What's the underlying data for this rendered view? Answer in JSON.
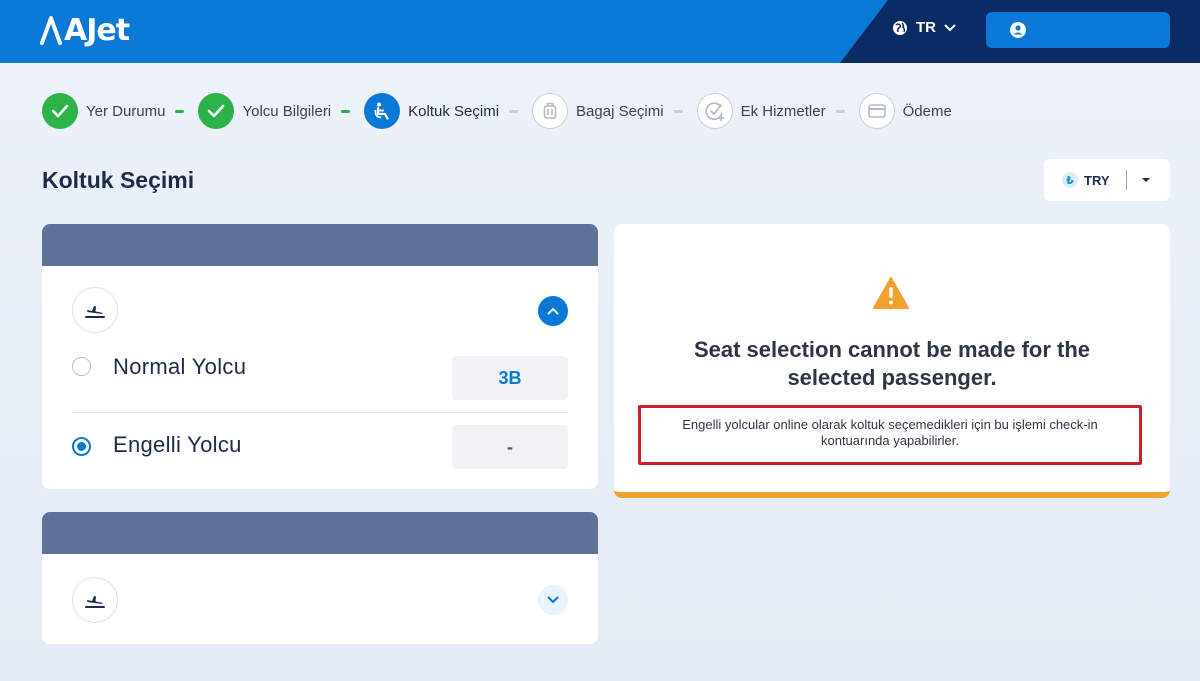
{
  "header": {
    "logo_text": "AJet",
    "language": "TR",
    "colors": {
      "primary": "#0a78d7",
      "dark": "#0a2b63"
    }
  },
  "stepper": {
    "steps": [
      {
        "label": "Yer Durumu",
        "state": "done",
        "icon": "check-icon"
      },
      {
        "label": "Yolcu Bilgileri",
        "state": "done",
        "icon": "check-icon"
      },
      {
        "label": "Koltuk Seçimi",
        "state": "active",
        "icon": "seat-icon"
      },
      {
        "label": "Bagaj Seçimi",
        "state": "pending",
        "icon": "baggage-icon"
      },
      {
        "label": "Ek Hizmetler",
        "state": "pending",
        "icon": "add-services-icon"
      },
      {
        "label": "Ödeme",
        "state": "pending",
        "icon": "card-icon"
      }
    ]
  },
  "page": {
    "title": "Koltuk Seçimi",
    "currency": {
      "symbol": "₺",
      "code": "TRY"
    }
  },
  "flights": [
    {
      "expanded": true,
      "icon": "departure-icon",
      "passengers": [
        {
          "label": "Normal Yolcu",
          "seat": "3B",
          "selected": false
        },
        {
          "label": "Engelli Yolcu",
          "seat": "-",
          "selected": true
        }
      ]
    },
    {
      "expanded": false,
      "icon": "departure-icon"
    }
  ],
  "alert": {
    "icon": "warning-icon",
    "title": "Seat selection cannot be made for the selected passenger.",
    "message": "Engelli yolcular online olarak koltuk seçemedikleri için bu işlemi check-in kontuarında yapabilirler.",
    "colors": {
      "accent": "#f0a12e",
      "highlight_border": "#cc1f2b"
    }
  }
}
